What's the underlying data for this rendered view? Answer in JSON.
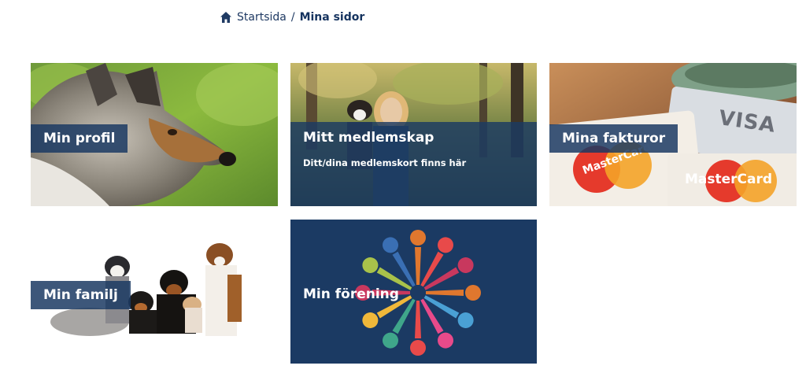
{
  "breadcrumb": {
    "home_icon": "home-icon",
    "home_label": "Startsida",
    "separator": "/",
    "current": "Mina sidor"
  },
  "tiles": [
    {
      "title": "Min profil"
    },
    {
      "title": "Mitt medlemskap",
      "subtitle": "Ditt/dina medlemskort finns här"
    },
    {
      "title": "Mina fakturor"
    },
    {
      "title": "Min familj"
    },
    {
      "title": "Min förening"
    }
  ],
  "card_logos": {
    "visa": "VISA",
    "mastercard_1": "MasterCard",
    "mastercard_2": "MasterCard"
  },
  "colors": {
    "brand_navy": "#1b3a63",
    "overlay": "rgba(27,58,99,0.85)"
  }
}
